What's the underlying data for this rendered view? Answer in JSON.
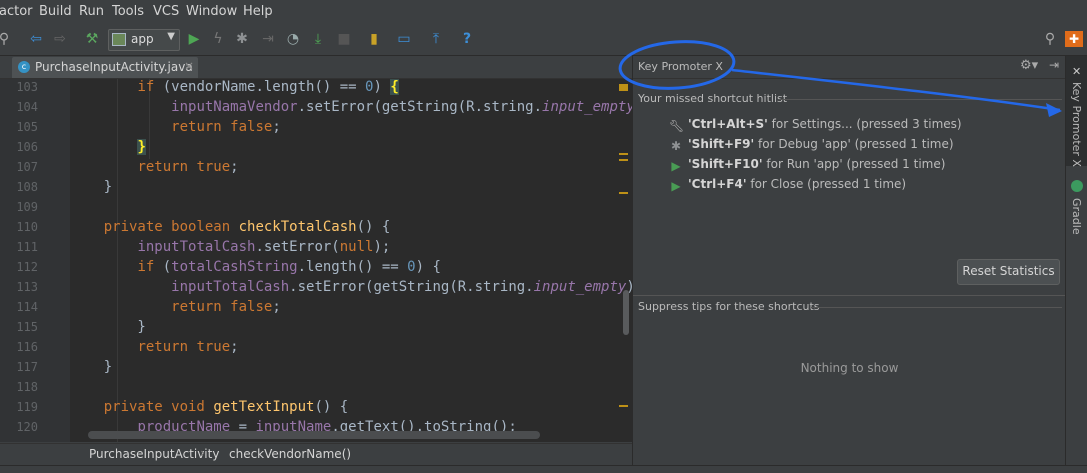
{
  "menu": [
    "actor",
    "Build",
    "Run",
    "Tools",
    "VCS",
    "Window",
    "Help"
  ],
  "toolbar": {
    "run_config": "app",
    "icons": [
      "search-everywhere-icon",
      "back-icon",
      "forward-icon",
      "make-project-icon",
      "run-config-icon",
      "run-icon",
      "apply-changes-icon",
      "debug-icon",
      "attach-debugger-icon",
      "profile-icon",
      "sync-icon",
      "stop-icon",
      "sdk-manager-icon",
      "avd-manager-icon",
      "sync-gradle-icon",
      "help-icon",
      "search-icon",
      "plugin-icon"
    ]
  },
  "tab": {
    "label": "PurchaseInputActivity.java",
    "close": "×"
  },
  "editor": {
    "line_numbers": [
      "103",
      "104",
      "105",
      "106",
      "107",
      "108",
      "109",
      "110",
      "111",
      "112",
      "113",
      "114",
      "115",
      "116",
      "117",
      "118",
      "119",
      "120"
    ]
  },
  "breadcrumb": {
    "class": "PurchaseInputActivity",
    "separator": "›",
    "method": "checkVendorName()"
  },
  "key_promoter": {
    "title": "Key Promoter X",
    "hitlist_title": "Your missed shortcut hitlist",
    "hits": [
      {
        "icon": "wrench-icon",
        "shortcut": "'Ctrl+Alt+S'",
        "text": " for Settings... (pressed 3 times)"
      },
      {
        "icon": "debug-icon",
        "shortcut": "'Shift+F9'",
        "text": " for Debug 'app' (pressed 1 time)"
      },
      {
        "icon": "run-icon",
        "shortcut": "'Shift+F10'",
        "text": " for Run 'app' (pressed 1 time)"
      },
      {
        "icon": "run-icon",
        "shortcut": "'Ctrl+F4'",
        "text": " for Close (pressed 1 time)"
      }
    ],
    "reset_button": "Reset Statistics",
    "suppress_title": "Suppress tips for these shortcuts",
    "empty_text": "Nothing to show"
  },
  "right_strip": {
    "key_promoter_tab": "Key Promoter X",
    "gradle_tab": "Gradle"
  },
  "colors": {
    "annotation": "#2468e8",
    "keyword": "#cc7832",
    "function": "#ffc66d",
    "field": "#9876aa",
    "number": "#6897bb"
  }
}
